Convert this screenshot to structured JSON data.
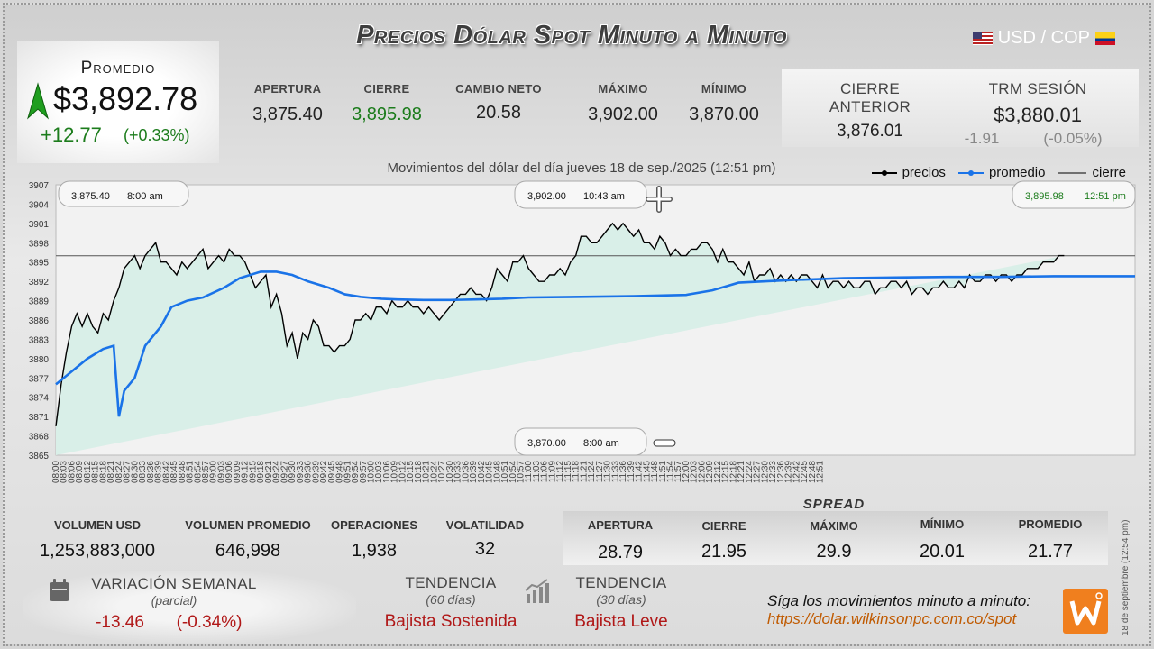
{
  "header": {
    "title": "Precios Dólar Spot Minuto a Minuto",
    "pair": "USD / COP"
  },
  "promedio": {
    "label": "Promedio",
    "value": "$3,892.78",
    "change": "+12.77",
    "change_pct": "(+0.33%)"
  },
  "stats": [
    {
      "label": "APERTURA",
      "value": "3,875.40"
    },
    {
      "label": "CIERRE",
      "value": "3,895.98"
    },
    {
      "label": "CAMBIO NETO",
      "value": "20.58"
    },
    {
      "label": "MÁXIMO",
      "value": "3,902.00"
    },
    {
      "label": "MÍNIMO",
      "value": "3,870.00"
    }
  ],
  "previous": {
    "cierre_anterior_label": "CIERRE ANTERIOR",
    "cierre_anterior_value": "3,876.01",
    "trm_label": "TRM SESIÓN",
    "trm_value": "$3,880.01",
    "trm_diff": "-1.91",
    "trm_diff_pct": "(-0.05%)"
  },
  "chart_data": {
    "type": "line",
    "subtitle": "Movimientos del dólar del día jueves 18 de sep./2025 (12:51 pm)",
    "legend": [
      "precios",
      "promedio",
      "cierre"
    ],
    "ylim": [
      3865,
      3907
    ],
    "y_ticks": [
      3907,
      3904,
      3901,
      3898,
      3895,
      3892,
      3889,
      3886,
      3883,
      3880,
      3877,
      3874,
      3871,
      3868,
      3865
    ],
    "x_ticks": [
      "08:00",
      "08:03",
      "08:06",
      "08:09",
      "08:12",
      "08:15",
      "08:18",
      "08:21",
      "08:24",
      "08:27",
      "08:30",
      "08:33",
      "08:36",
      "08:39",
      "08:42",
      "08:45",
      "08:48",
      "08:51",
      "08:54",
      "08:57",
      "09:00",
      "09:03",
      "09:06",
      "09:09",
      "09:12",
      "09:15",
      "09:18",
      "09:21",
      "09:24",
      "09:27",
      "09:30",
      "09:33",
      "09:36",
      "09:39",
      "09:42",
      "09:45",
      "09:48",
      "09:51",
      "09:54",
      "09:57",
      "10:00",
      "10:03",
      "10:06",
      "10:09",
      "10:12",
      "10:15",
      "10:18",
      "10:21",
      "10:24",
      "10:27",
      "10:30",
      "10:33",
      "10:36",
      "10:39",
      "10:42",
      "10:45",
      "10:48",
      "10:51",
      "10:54",
      "10:57",
      "11:00",
      "11:03",
      "11:06",
      "11:09",
      "11:12",
      "11:15",
      "11:18",
      "11:21",
      "11:24",
      "11:27",
      "11:30",
      "11:33",
      "11:36",
      "11:39",
      "11:42",
      "11:45",
      "11:48",
      "11:51",
      "11:54",
      "11:57",
      "12:00",
      "12:03",
      "12:06",
      "12:09",
      "12:12",
      "12:15",
      "12:18",
      "12:21",
      "12:24",
      "12:27",
      "12:30",
      "12:33",
      "12:36",
      "12:39",
      "12:42",
      "12:45",
      "12:48",
      "12:51"
    ],
    "close_line": 3895.98,
    "series": [
      {
        "name": "precios",
        "color": "#000000",
        "x_minutes": [
          0,
          2,
          4,
          6,
          8,
          10,
          12,
          14,
          16,
          18,
          20,
          22,
          24,
          26,
          28,
          30,
          32,
          34,
          36,
          38,
          40,
          42,
          44,
          46,
          48,
          50,
          52,
          54,
          56,
          58,
          60,
          62,
          64,
          66,
          68,
          70,
          72,
          74,
          76,
          78,
          80,
          82,
          84,
          86,
          88,
          90,
          92,
          94,
          96,
          98,
          100,
          102,
          104,
          106,
          108,
          110,
          112,
          114,
          116,
          118,
          120,
          122,
          124,
          126,
          128,
          130,
          132,
          134,
          136,
          138,
          140,
          142,
          144,
          146,
          148,
          150,
          152,
          154,
          156,
          158,
          160,
          162,
          164,
          166,
          168,
          170,
          172,
          174,
          176,
          178,
          180,
          182,
          184,
          186,
          188,
          190,
          192,
          194,
          196,
          198,
          200,
          202,
          204,
          206,
          208,
          210,
          212,
          214,
          216,
          218,
          220,
          222,
          224,
          226,
          228,
          230,
          232,
          234,
          236,
          238,
          240,
          242,
          244,
          246,
          248,
          250,
          252,
          254,
          256,
          258,
          260,
          262,
          264,
          266,
          268,
          270,
          272,
          274,
          276,
          278,
          280,
          282,
          284,
          286,
          288,
          290,
          292,
          294,
          296,
          298,
          300,
          302,
          304,
          306,
          308,
          310,
          312,
          314,
          316,
          318,
          320,
          322,
          324,
          326,
          328,
          330,
          332,
          334,
          336,
          338,
          340,
          342,
          344,
          346,
          348,
          350,
          352,
          354,
          356,
          358,
          360,
          362,
          364,
          366,
          368,
          370,
          372,
          374,
          376,
          378,
          380,
          382,
          384,
          386,
          388,
          390,
          392,
          394,
          396,
          398,
          400,
          402,
          404,
          406,
          408,
          410,
          411
        ],
        "values": [
          3869.5,
          3876,
          3881,
          3885,
          3887,
          3885,
          3887,
          3885,
          3884,
          3887,
          3886,
          3889,
          3891,
          3894,
          3895,
          3896,
          3894,
          3896,
          3897,
          3898,
          3895,
          3895,
          3894,
          3893,
          3895,
          3894,
          3895,
          3896,
          3897,
          3894,
          3895,
          3896,
          3895,
          3897,
          3896,
          3896,
          3895,
          3893,
          3891,
          3892,
          3893,
          3888,
          3890,
          3887,
          3882,
          3884,
          3880,
          3884,
          3883,
          3886,
          3885,
          3882,
          3882,
          3881,
          3882,
          3882,
          3883,
          3886,
          3886,
          3887,
          3886,
          3888,
          3888,
          3887,
          3889,
          3888,
          3888,
          3889,
          3888,
          3888,
          3887,
          3888,
          3887,
          3886,
          3887,
          3888,
          3889,
          3890,
          3890,
          3891,
          3890,
          3890,
          3889,
          3891,
          3894,
          3893,
          3892,
          3895,
          3895,
          3896,
          3894,
          3893,
          3892,
          3892,
          3893,
          3893,
          3894,
          3893,
          3895,
          3896,
          3899,
          3899,
          3898,
          3898,
          3899,
          3900,
          3901,
          3900,
          3901,
          3900,
          3899,
          3900,
          3898,
          3898,
          3897,
          3899,
          3898,
          3896,
          3897,
          3896,
          3896,
          3897,
          3897,
          3898,
          3898,
          3897,
          3895,
          3897,
          3895,
          3895,
          3894,
          3893,
          3895,
          3892,
          3893,
          3893,
          3894,
          3892,
          3893,
          3892,
          3893,
          3892,
          3893,
          3893,
          3892,
          3891,
          3893,
          3891,
          3892,
          3892,
          3891,
          3892,
          3891,
          3891,
          3892,
          3892,
          3890,
          3891,
          3891,
          3892,
          3892,
          3891,
          3892,
          3890,
          3891,
          3891,
          3890,
          3891,
          3891,
          3892,
          3891,
          3891,
          3892,
          3891,
          3893,
          3892,
          3892,
          3893,
          3893,
          3892,
          3893,
          3893,
          3892,
          3893,
          3893,
          3894,
          3894,
          3894,
          3895,
          3895,
          3895,
          3896,
          3896
        ]
      },
      {
        "name": "promedio",
        "color": "#1a73e8",
        "x_minutes": [
          0,
          6,
          12,
          18,
          22,
          24,
          26,
          30,
          34,
          36,
          40,
          44,
          50,
          56,
          64,
          70,
          74,
          78,
          84,
          90,
          96,
          104,
          110,
          116,
          124,
          130,
          140,
          150,
          160,
          170,
          180,
          200,
          220,
          240,
          250,
          255,
          260,
          280,
          300,
          320,
          340,
          360,
          380,
          400,
          411
        ],
        "values": [
          3876,
          3878,
          3880,
          3881.5,
          3882,
          3871,
          3875,
          3877,
          3882,
          3883,
          3885,
          3888,
          3889,
          3889.5,
          3891,
          3892.5,
          3893,
          3893.5,
          3893.5,
          3893,
          3892,
          3891,
          3890,
          3889.6,
          3889.3,
          3889.2,
          3889.1,
          3889.1,
          3889.2,
          3889.3,
          3889.5,
          3889.6,
          3889.7,
          3889.9,
          3890.6,
          3891.2,
          3891.8,
          3892.2,
          3892.5,
          3892.6,
          3892.7,
          3892.7,
          3892.8,
          3892.8,
          3892.8
        ]
      }
    ],
    "annotations": [
      {
        "label": "3,875.40",
        "time": "8:00 am"
      },
      {
        "label": "3,902.00",
        "time": "10:43 am"
      },
      {
        "label": "3,895.98",
        "time": "12:51 pm"
      },
      {
        "label": "3,870.00",
        "time": "8:00 am"
      }
    ]
  },
  "volume": [
    {
      "label": "VOLUMEN USD",
      "value": "1,253,883,000"
    },
    {
      "label": "VOLUMEN PROMEDIO",
      "value": "646,998"
    },
    {
      "label": "OPERACIONES",
      "value": "1,938"
    },
    {
      "label": "VOLATILIDAD",
      "value": "32"
    }
  ],
  "spread": {
    "title": "SPREAD",
    "items": [
      {
        "label": "APERTURA",
        "value": "28.79"
      },
      {
        "label": "CIERRE",
        "value": "21.95"
      },
      {
        "label": "MÁXIMO",
        "value": "29.9"
      },
      {
        "label": "MÍNIMO",
        "value": "20.01"
      },
      {
        "label": "PROMEDIO",
        "value": "21.77"
      }
    ]
  },
  "weekly": {
    "label": "VARIACIÓN SEMANAL",
    "sub": "(parcial)",
    "value": "-13.46",
    "pct": "(-0.34%)"
  },
  "trend60": {
    "label": "TENDENCIA",
    "sub": "(60 días)",
    "value": "Bajista Sostenida"
  },
  "trend30": {
    "label": "TENDENCIA",
    "sub": "(30 días)",
    "value": "Bajista Leve"
  },
  "footer": {
    "follow": "Síga los movimientos minuto a minuto:",
    "url": "https://dolar.wilkinsonpc.com.co/spot",
    "stamp": "18 de septiembre (12:54 pm)"
  },
  "colors": {
    "positive": "#1c7c1c",
    "negative": "#b01818",
    "promedio": "#1a73e8",
    "fill": "#d9efe8"
  }
}
